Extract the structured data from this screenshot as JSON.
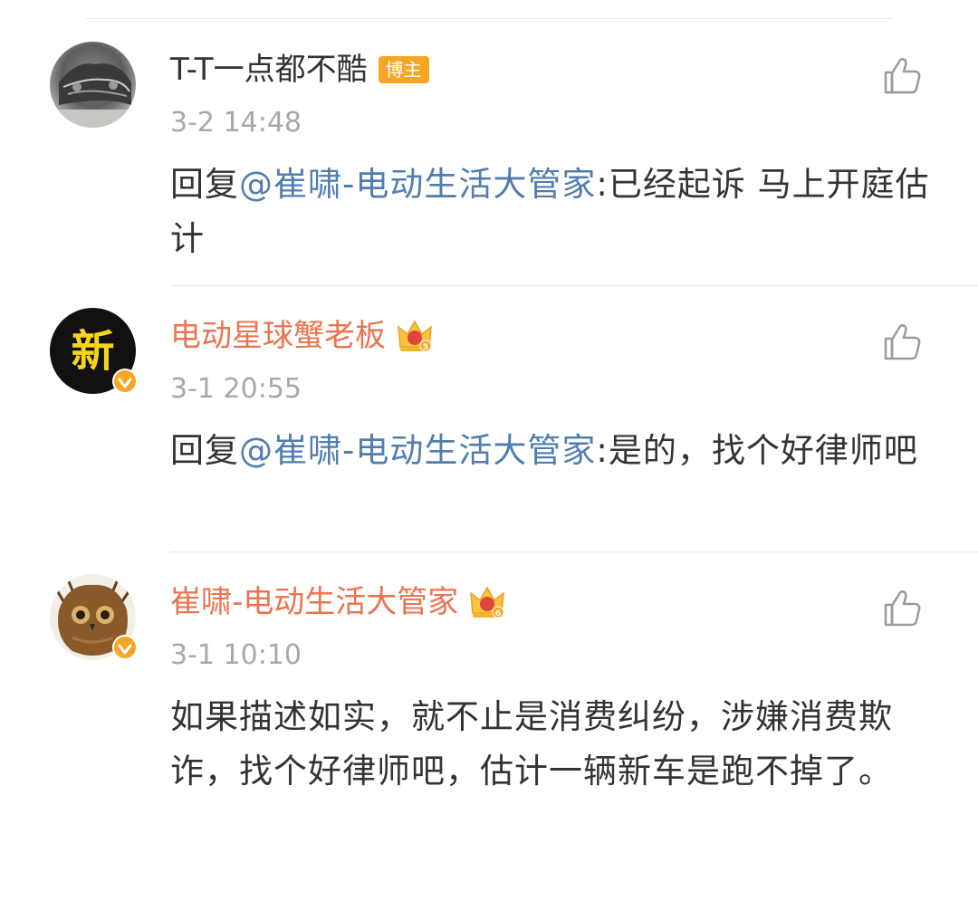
{
  "comments": [
    {
      "username": "T-T一点都不酷",
      "tag": "博主",
      "timestamp": "3-2 14:48",
      "reply_prefix": "回复",
      "mention": "@崔啸-电动生活大管家",
      "content": ":已经起诉 马上开庭估计",
      "avatar_icon": "car-photo-avatar"
    },
    {
      "username": "电动星球蟹老板",
      "crown_level": "5",
      "timestamp": "3-1 20:55",
      "reply_prefix": "回复",
      "mention": "@崔啸-电动生活大管家",
      "content": ":是的，找个好律师吧",
      "avatar_text": "新",
      "avatar_icon": "xin-logo-avatar"
    },
    {
      "username": "崔啸-电动生活大管家",
      "crown_level": "6",
      "timestamp": "3-1 10:10",
      "content": "如果描述如实，就不止是消费纠纷，涉嫌消费欺诈，找个好律师吧，估计一辆新车是跑不掉了。",
      "avatar_icon": "owl-photo-avatar"
    }
  ],
  "colors": {
    "username_default": "#333333",
    "username_vip": "#eb7350",
    "mention": "#507daf",
    "timestamp": "#a8a8a8",
    "tag_bg": "#f5a623",
    "verified": "#f5a623"
  }
}
